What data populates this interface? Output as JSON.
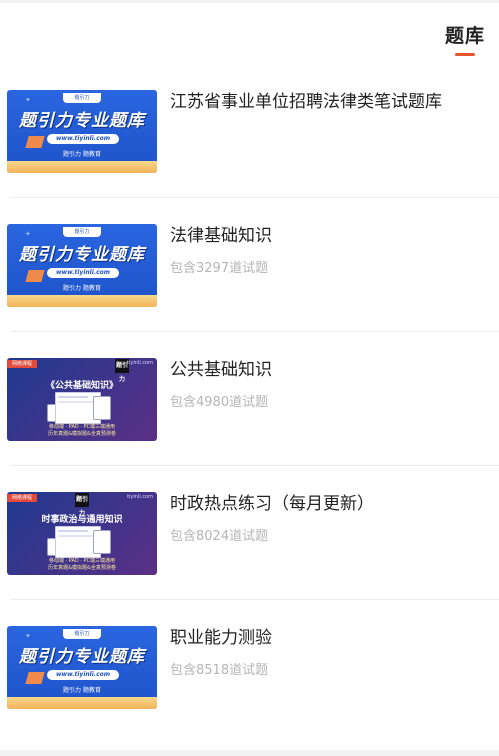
{
  "header": {
    "active_tab": "题库"
  },
  "thumbnails": {
    "promo": {
      "badge": "题引力",
      "headline": "题引力专业题库",
      "url": "www.tiyinli.com",
      "slogan": "题引力 题教育"
    },
    "course_public": {
      "tag": "网络课程",
      "site": "tiyinli.com",
      "logo": "题引力",
      "title": "《公共基础知识》",
      "caption_1": "移动端 · PAD · PC端三端通用",
      "caption_2": "历年真题&模拟题&全真预测卷"
    },
    "course_politics": {
      "tag": "网络课程",
      "site": "tiyinli.com",
      "logo": "题引力",
      "title": "时事政治与通用知识",
      "caption_1": "移动端 · PAD · PC端三端通用",
      "caption_2": "历年真题&模拟题&全真预测卷"
    }
  },
  "items": [
    {
      "title": "江苏省事业单位招聘法律类笔试题库",
      "subtitle": ""
    },
    {
      "title": "法律基础知识",
      "subtitle": "包含3297道试题"
    },
    {
      "title": "公共基础知识",
      "subtitle": "包含4980道试题"
    },
    {
      "title": "时政热点练习（每月更新）",
      "subtitle": "包含8024道试题"
    },
    {
      "title": "职业能力测验",
      "subtitle": "包含8518道试题"
    }
  ],
  "colors": {
    "accent": "#e8552b",
    "title_text": "#222222",
    "sub_text": "#b5b5b5",
    "promo_blue": "#1e52c9",
    "promo_gold": "#f3b45a"
  }
}
